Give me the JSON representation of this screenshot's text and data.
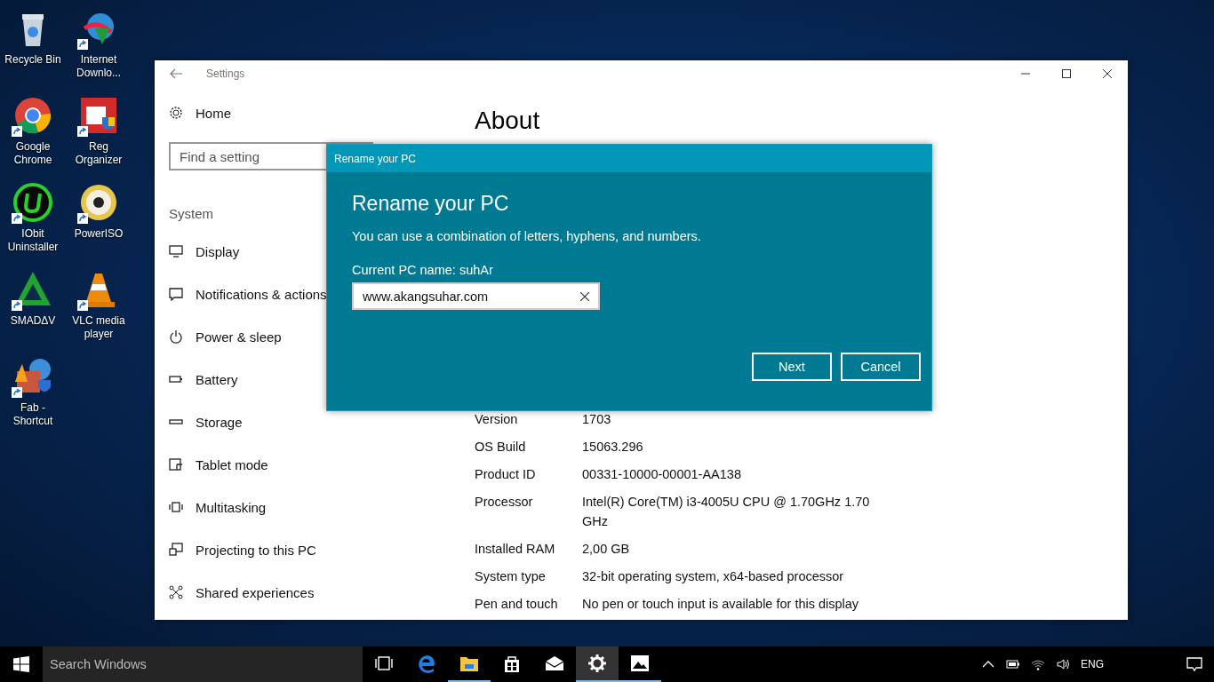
{
  "desktop_icons": [
    {
      "label": "Recycle Bin",
      "kind": "bin",
      "shortcut": false
    },
    {
      "label": "Internet Downlo...",
      "kind": "download",
      "shortcut": true
    },
    {
      "label": "Google Chrome",
      "kind": "browser",
      "shortcut": true
    },
    {
      "label": "Reg Organizer",
      "kind": "registry",
      "shortcut": true
    },
    {
      "label": "IObit Uninstaller",
      "kind": "uninstaller",
      "shortcut": true
    },
    {
      "label": "PowerISO",
      "kind": "disc",
      "shortcut": true
    },
    {
      "label": "SMADΔV",
      "kind": "triangle",
      "shortcut": true
    },
    {
      "label": "VLC media player",
      "kind": "cone",
      "shortcut": true
    },
    {
      "label": "Fab - Shortcut",
      "kind": "shield",
      "shortcut": true
    }
  ],
  "window": {
    "title": "Settings"
  },
  "sidebar": {
    "home": "Home",
    "search": {
      "placeholder": "Find a setting"
    },
    "section": "System",
    "items": [
      {
        "label": "Display",
        "kind": "monitor"
      },
      {
        "label": "Notifications & actions",
        "kind": "message"
      },
      {
        "label": "Power & sleep",
        "kind": "power"
      },
      {
        "label": "Battery",
        "kind": "battery"
      },
      {
        "label": "Storage",
        "kind": "storage"
      },
      {
        "label": "Tablet mode",
        "kind": "tablet"
      },
      {
        "label": "Multitasking",
        "kind": "multitask"
      },
      {
        "label": "Projecting to this PC",
        "kind": "project"
      },
      {
        "label": "Shared experiences",
        "kind": "share"
      }
    ]
  },
  "content": {
    "heading": "About",
    "specs": [
      {
        "label": "Version",
        "value": "1703"
      },
      {
        "label": "OS Build",
        "value": "15063.296"
      },
      {
        "label": "Product ID",
        "value": "00331-10000-00001-AA138"
      },
      {
        "label": "Processor",
        "value": "Intel(R) Core(TM) i3-4005U CPU @ 1.70GHz   1.70 GHz"
      },
      {
        "label": "Installed RAM",
        "value": "2,00 GB"
      },
      {
        "label": "System type",
        "value": "32-bit operating system, x64-based processor"
      },
      {
        "label": "Pen and touch",
        "value": "No pen or touch input is available for this display"
      }
    ]
  },
  "dialog": {
    "title_bar": "Rename your PC",
    "heading": "Rename your PC",
    "description": "You can use a combination of letters, hyphens, and numbers.",
    "current_name": "Current PC name: suhAr",
    "name_field": {
      "value": "www.akangsuhar.com"
    },
    "buttons": [
      "Next",
      "Cancel"
    ]
  },
  "taskbar": {
    "search": {
      "placeholder": "Search Windows"
    },
    "apps": [
      {
        "kind": "taskview",
        "running": false,
        "selected": false
      },
      {
        "kind": "edge",
        "running": false,
        "selected": false
      },
      {
        "kind": "folder",
        "running": true,
        "selected": false
      },
      {
        "kind": "store",
        "running": false,
        "selected": false
      },
      {
        "kind": "mail",
        "running": false,
        "selected": false
      },
      {
        "kind": "gear",
        "running": true,
        "selected": true
      },
      {
        "kind": "photos",
        "running": true,
        "selected": false
      }
    ],
    "language": "ENG"
  }
}
